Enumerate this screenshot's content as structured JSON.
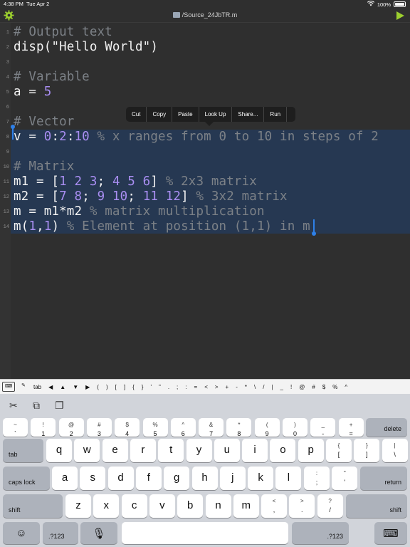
{
  "status": {
    "time": "4:38 PM",
    "date": "Tue Apr 2",
    "battery": "100%",
    "wifi_icon": "wifi-icon"
  },
  "nav": {
    "title": "/Source_24JbTR.m",
    "settings_icon": "gear-icon",
    "run_icon": "play-icon",
    "accent_color": "#9ccf2f"
  },
  "editor": {
    "lines": [
      {
        "n": "1",
        "tokens": [
          {
            "t": "# Output text",
            "c": "comment"
          }
        ]
      },
      {
        "n": "2",
        "tokens": [
          {
            "t": "disp(",
            "c": "plain"
          },
          {
            "t": "\"Hello World\"",
            "c": "str"
          },
          {
            "t": ")",
            "c": "plain"
          }
        ]
      },
      {
        "n": "3",
        "tokens": []
      },
      {
        "n": "4",
        "tokens": [
          {
            "t": "# Variable",
            "c": "comment"
          }
        ]
      },
      {
        "n": "5",
        "tokens": [
          {
            "t": "a = ",
            "c": "plain"
          },
          {
            "t": "5",
            "c": "num"
          }
        ]
      },
      {
        "n": "6",
        "tokens": []
      },
      {
        "n": "7",
        "tokens": [
          {
            "t": "# Vector",
            "c": "comment"
          }
        ]
      },
      {
        "n": "8",
        "tokens": [
          {
            "t": "v = ",
            "c": "plain"
          },
          {
            "t": "0",
            "c": "num"
          },
          {
            "t": ":",
            "c": "plain"
          },
          {
            "t": "2",
            "c": "num"
          },
          {
            "t": ":",
            "c": "plain"
          },
          {
            "t": "10",
            "c": "num"
          },
          {
            "t": " % x ranges from 0 to 10 in steps of 2",
            "c": "comment"
          }
        ]
      },
      {
        "n": "9",
        "tokens": []
      },
      {
        "n": "10",
        "tokens": [
          {
            "t": "# Matrix",
            "c": "comment"
          }
        ]
      },
      {
        "n": "11",
        "tokens": [
          {
            "t": "m1 = [",
            "c": "plain"
          },
          {
            "t": "1 2 3",
            "c": "num"
          },
          {
            "t": "; ",
            "c": "plain"
          },
          {
            "t": "4 5 6",
            "c": "num"
          },
          {
            "t": "]",
            "c": "plain"
          },
          {
            "t": " % 2x3 matrix",
            "c": "comment"
          }
        ]
      },
      {
        "n": "12",
        "tokens": [
          {
            "t": "m2 = [",
            "c": "plain"
          },
          {
            "t": "7 8",
            "c": "num"
          },
          {
            "t": "; ",
            "c": "plain"
          },
          {
            "t": "9 10",
            "c": "num"
          },
          {
            "t": "; ",
            "c": "plain"
          },
          {
            "t": "11 12",
            "c": "num"
          },
          {
            "t": "]",
            "c": "plain"
          },
          {
            "t": " % 3x2 matrix",
            "c": "comment"
          }
        ]
      },
      {
        "n": "13",
        "tokens": [
          {
            "t": "m = m1*m2",
            "c": "plain"
          },
          {
            "t": " % matrix multiplication",
            "c": "comment"
          }
        ]
      },
      {
        "n": "14",
        "tokens": [
          {
            "t": "m(",
            "c": "plain"
          },
          {
            "t": "1",
            "c": "num"
          },
          {
            "t": ",",
            "c": "plain"
          },
          {
            "t": "1",
            "c": "num"
          },
          {
            "t": ")",
            "c": "plain"
          },
          {
            "t": " % Element at position (1,1) in m",
            "c": "comment"
          }
        ]
      }
    ]
  },
  "context_menu": [
    "Cut",
    "Copy",
    "Paste",
    "Look Up",
    "Share...",
    "Run"
  ],
  "symbol_bar": [
    "tab",
    "◀",
    "▲",
    "▼",
    "▶",
    "(",
    ")",
    "[",
    "]",
    "{",
    "}",
    "'",
    "\"",
    ".",
    ";",
    ":",
    "=",
    "<",
    ">",
    "+",
    "-",
    "*",
    "\\",
    "/",
    "|",
    "_",
    "!",
    "@",
    "#",
    "$",
    "%",
    "^"
  ],
  "keyboard": {
    "row_numbers": [
      {
        "top": "~",
        "bot": "`"
      },
      {
        "top": "!",
        "bot": "1"
      },
      {
        "top": "@",
        "bot": "2"
      },
      {
        "top": "#",
        "bot": "3"
      },
      {
        "top": "$",
        "bot": "4"
      },
      {
        "top": "%",
        "bot": "5"
      },
      {
        "top": "^",
        "bot": "6"
      },
      {
        "top": "&",
        "bot": "7"
      },
      {
        "top": "*",
        "bot": "8"
      },
      {
        "top": "(",
        "bot": "9"
      },
      {
        "top": ")",
        "bot": "0"
      },
      {
        "top": "_",
        "bot": "-"
      },
      {
        "top": "+",
        "bot": "="
      }
    ],
    "delete": "delete",
    "tab": "tab",
    "row_q": [
      "q",
      "w",
      "e",
      "r",
      "t",
      "y",
      "u",
      "i",
      "o",
      "p"
    ],
    "row_q_sym": [
      {
        "top": "{",
        "bot": "["
      },
      {
        "top": "}",
        "bot": "]"
      },
      {
        "top": "|",
        "bot": "\\"
      }
    ],
    "caps": "caps lock",
    "row_a": [
      "a",
      "s",
      "d",
      "f",
      "g",
      "h",
      "j",
      "k",
      "l"
    ],
    "row_a_sym": [
      {
        "top": ":",
        "bot": ";"
      },
      {
        "top": "\"",
        "bot": "'"
      }
    ],
    "return": "return",
    "shift": "shift",
    "row_z": [
      "z",
      "x",
      "c",
      "v",
      "b",
      "n",
      "m"
    ],
    "row_z_sym": [
      {
        "top": "<",
        "bot": ","
      },
      {
        "top": ">",
        "bot": "."
      },
      {
        "top": "?",
        "bot": "/"
      }
    ],
    "num_label": ".?123",
    "emoji_icon": "emoji-icon",
    "mic_icon": "microphone-icon",
    "hide_icon": "keyboard-hide-icon"
  }
}
